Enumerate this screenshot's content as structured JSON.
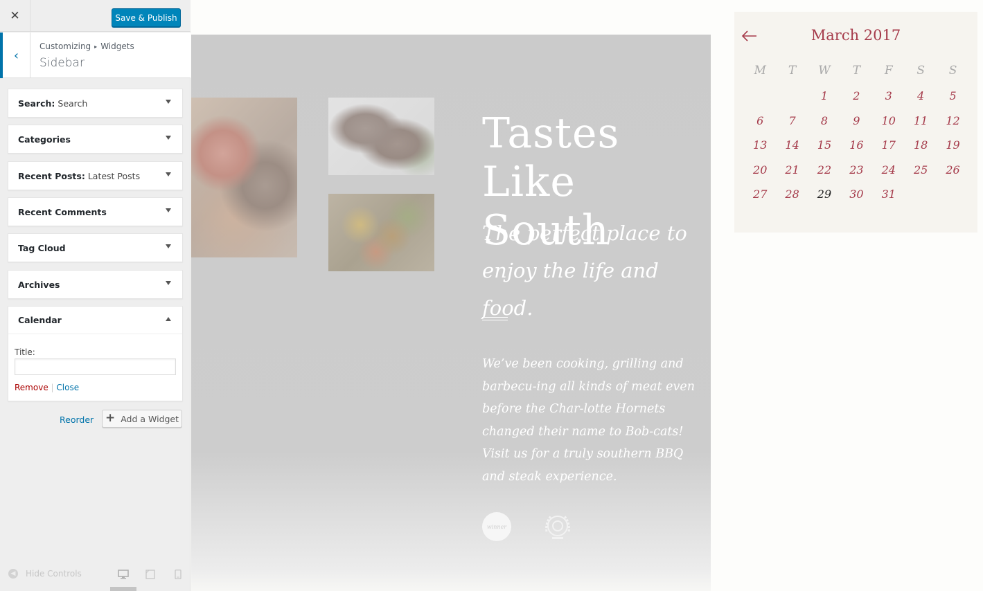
{
  "customizer": {
    "close_glyph": "✕",
    "publish_label": "Save & Publish",
    "back_glyph": "‹",
    "breadcrumb": {
      "root": "Customizing",
      "separator": "▸",
      "parent": "Widgets"
    },
    "section_title": "Sidebar",
    "widgets": [
      {
        "name": "Search:",
        "sub": "Search",
        "expanded": false
      },
      {
        "name": "Categories",
        "sub": "",
        "expanded": false
      },
      {
        "name": "Recent Posts:",
        "sub": "Latest Posts",
        "expanded": false
      },
      {
        "name": "Recent Comments",
        "sub": "",
        "expanded": false
      },
      {
        "name": "Tag Cloud",
        "sub": "",
        "expanded": false
      },
      {
        "name": "Archives",
        "sub": "",
        "expanded": false
      },
      {
        "name": "Calendar",
        "sub": "",
        "expanded": true
      }
    ],
    "calendar_form": {
      "title_label": "Title:",
      "title_value": "",
      "remove_label": "Remove",
      "separator": "|",
      "close_label": "Close"
    },
    "reorder_label": "Reorder",
    "add_widget_label": "Add a Widget",
    "add_widget_glyph": "+",
    "footer": {
      "hide_controls_label": "Hide Controls",
      "active_device": "desktop"
    },
    "colors": {
      "primary": "#0085ba",
      "link": "#0073aa",
      "remove": "#aa0000"
    }
  },
  "preview": {
    "hero": {
      "title_line1": "Tastes",
      "title_line2": "Like South",
      "subtitle": "The perfect place to enjoy the life and food.",
      "body": "We’ve been cooking, grilling and barbecu-ing all kinds of meat even before the Char-lotte Hornets changed their name to Bob-cats! Visit us for a truly southern BBQ and steak experience.",
      "award_1_text": "winner"
    },
    "calendar": {
      "caption": "March 2017",
      "weekdays": [
        "M",
        "T",
        "W",
        "T",
        "F",
        "S",
        "S"
      ],
      "weeks": [
        [
          "",
          "",
          "1",
          "2",
          "3",
          "4",
          "5"
        ],
        [
          "6",
          "7",
          "8",
          "9",
          "10",
          "11",
          "12"
        ],
        [
          "13",
          "14",
          "15",
          "16",
          "17",
          "18",
          "19"
        ],
        [
          "20",
          "21",
          "22",
          "23",
          "24",
          "25",
          "26"
        ],
        [
          "27",
          "28",
          "29",
          "30",
          "31",
          "",
          ""
        ]
      ],
      "today": "29",
      "accent_color": "#a53a4a"
    }
  }
}
